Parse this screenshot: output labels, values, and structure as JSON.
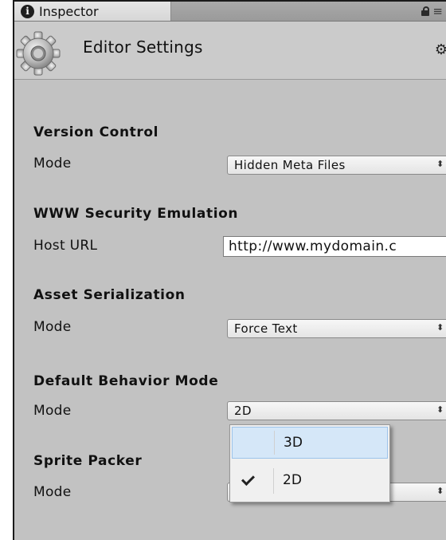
{
  "tab": {
    "label": "Inspector",
    "info_glyph": "i"
  },
  "header": {
    "title": "Editor Settings",
    "gear_menu": "⚙"
  },
  "sections": {
    "version_control": {
      "title": "Version Control",
      "label": "Mode",
      "value": "Hidden Meta Files"
    },
    "www_security": {
      "title": "WWW Security Emulation",
      "label": "Host URL",
      "value": "http://www.mydomain.c"
    },
    "asset_serialization": {
      "title": "Asset Serialization",
      "label": "Mode",
      "value": "Force Text"
    },
    "default_behavior": {
      "title": "Default Behavior Mode",
      "label": "Mode",
      "value": "2D"
    },
    "sprite_packer": {
      "title": "Sprite Packer",
      "label": "Mode",
      "value": ""
    }
  },
  "dropdown": {
    "options": [
      {
        "label": "3D",
        "selected": false,
        "highlighted": true
      },
      {
        "label": "2D",
        "selected": true,
        "highlighted": false
      }
    ]
  },
  "glyphs": {
    "popup_arrows": "⬍",
    "menu_lines": "≡"
  },
  "colors": {
    "panel_bg": "#c2c2c2",
    "highlight": "#d5e7f8",
    "highlight_border": "#9cc3ea"
  }
}
